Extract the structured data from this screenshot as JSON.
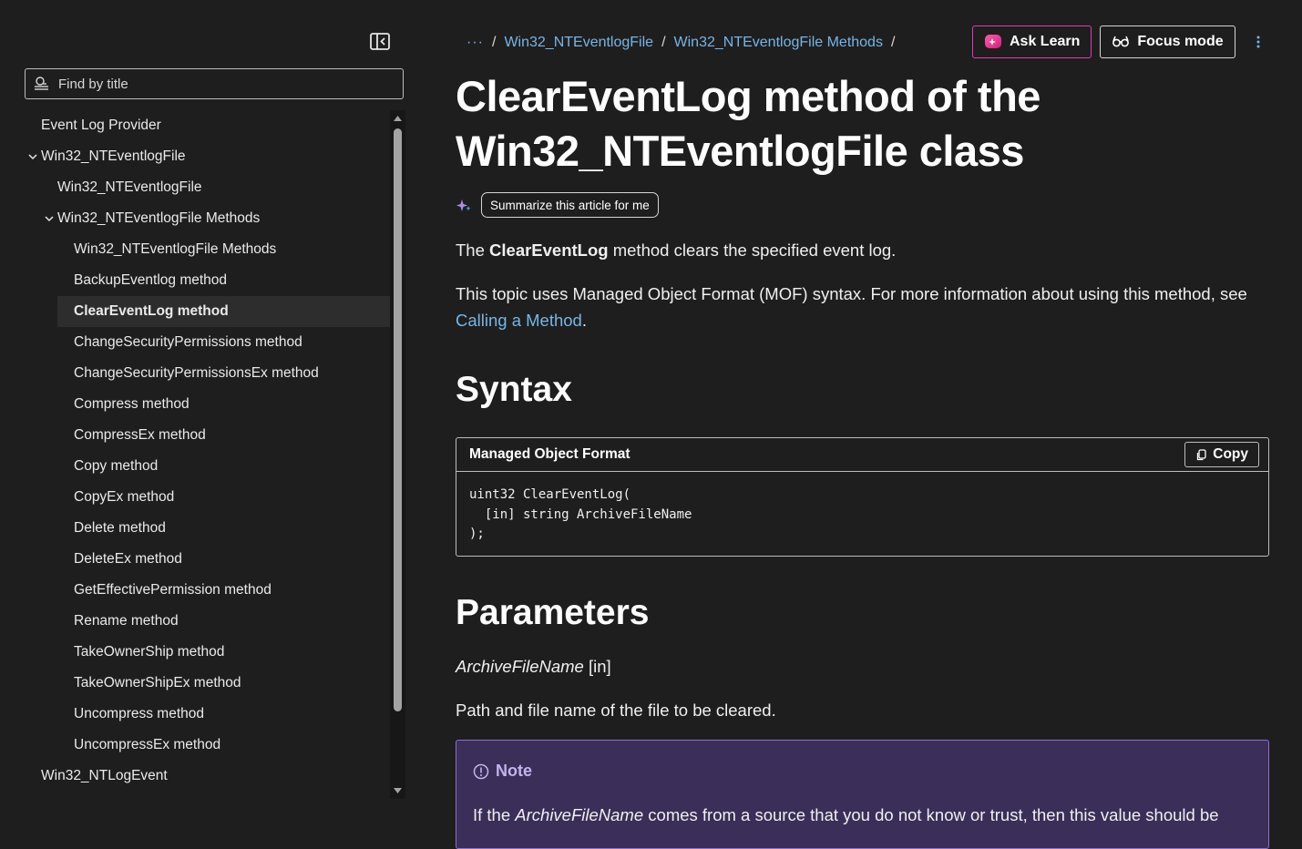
{
  "sidebar": {
    "filter_placeholder": "Find by title",
    "toc": [
      {
        "label": "Event Log Provider",
        "level": 0,
        "expanded": false
      },
      {
        "label": "Win32_NTEventlogFile",
        "level": 0,
        "expanded": true
      },
      {
        "label": "Win32_NTEventlogFile",
        "level": 1,
        "expanded": false
      },
      {
        "label": "Win32_NTEventlogFile Methods",
        "level": 1,
        "expanded": true
      },
      {
        "label": "Win32_NTEventlogFile Methods",
        "level": 2,
        "expanded": false
      },
      {
        "label": "BackupEventlog method",
        "level": 2,
        "expanded": false
      },
      {
        "label": "ClearEventLog method",
        "level": 2,
        "expanded": false,
        "active": true
      },
      {
        "label": "ChangeSecurityPermissions method",
        "level": 2,
        "expanded": false
      },
      {
        "label": "ChangeSecurityPermissionsEx method",
        "level": 2,
        "expanded": false
      },
      {
        "label": "Compress method",
        "level": 2,
        "expanded": false
      },
      {
        "label": "CompressEx method",
        "level": 2,
        "expanded": false
      },
      {
        "label": "Copy method",
        "level": 2,
        "expanded": false
      },
      {
        "label": "CopyEx method",
        "level": 2,
        "expanded": false
      },
      {
        "label": "Delete method",
        "level": 2,
        "expanded": false
      },
      {
        "label": "DeleteEx method",
        "level": 2,
        "expanded": false
      },
      {
        "label": "GetEffectivePermission method",
        "level": 2,
        "expanded": false
      },
      {
        "label": "Rename method",
        "level": 2,
        "expanded": false
      },
      {
        "label": "TakeOwnerShip method",
        "level": 2,
        "expanded": false
      },
      {
        "label": "TakeOwnerShipEx method",
        "level": 2,
        "expanded": false
      },
      {
        "label": "Uncompress method",
        "level": 2,
        "expanded": false
      },
      {
        "label": "UncompressEx method",
        "level": 2,
        "expanded": false
      },
      {
        "label": "Win32_NTLogEvent",
        "level": 0,
        "expanded": false
      }
    ]
  },
  "header": {
    "breadcrumb_more": "···",
    "breadcrumb": [
      "Win32_NTEventlogFile",
      "Win32_NTEventlogFile Methods"
    ],
    "separator": "/",
    "ask_learn_label": "Ask Learn",
    "focus_mode_label": "Focus mode"
  },
  "article": {
    "title": "ClearEventLog method of the Win32_NTEventlogFile class",
    "summarize_label": "Summarize this article for me",
    "intro": {
      "before": "The ",
      "bold": "ClearEventLog",
      "after": " method clears the specified event log."
    },
    "mof": {
      "text": "This topic uses Managed Object Format (MOF) syntax. For more information about using this method, see ",
      "link": "Calling a Method",
      "after": "."
    },
    "syntax_heading": "Syntax",
    "code": {
      "language_label": "Managed Object Format",
      "copy_label": "Copy",
      "content": "uint32 ClearEventLog(\n  [in] string ArchiveFileName\n);"
    },
    "parameters_heading": "Parameters",
    "param": {
      "name": "ArchiveFileName",
      "qualifier": " [in]",
      "description": "Path and file name of the file to be cleared."
    },
    "note": {
      "title": "Note",
      "text_before": "If the ",
      "text_italic": "ArchiveFileName",
      "text_after": " comes from a source that you do not know or trust, then this value should be"
    }
  },
  "colors": {
    "background": "#1f1e1e",
    "link": "#75b6e7",
    "ask_learn_border": "#e23ab4",
    "note_bg": "#3b2e58",
    "note_title": "#c4b3ee"
  }
}
